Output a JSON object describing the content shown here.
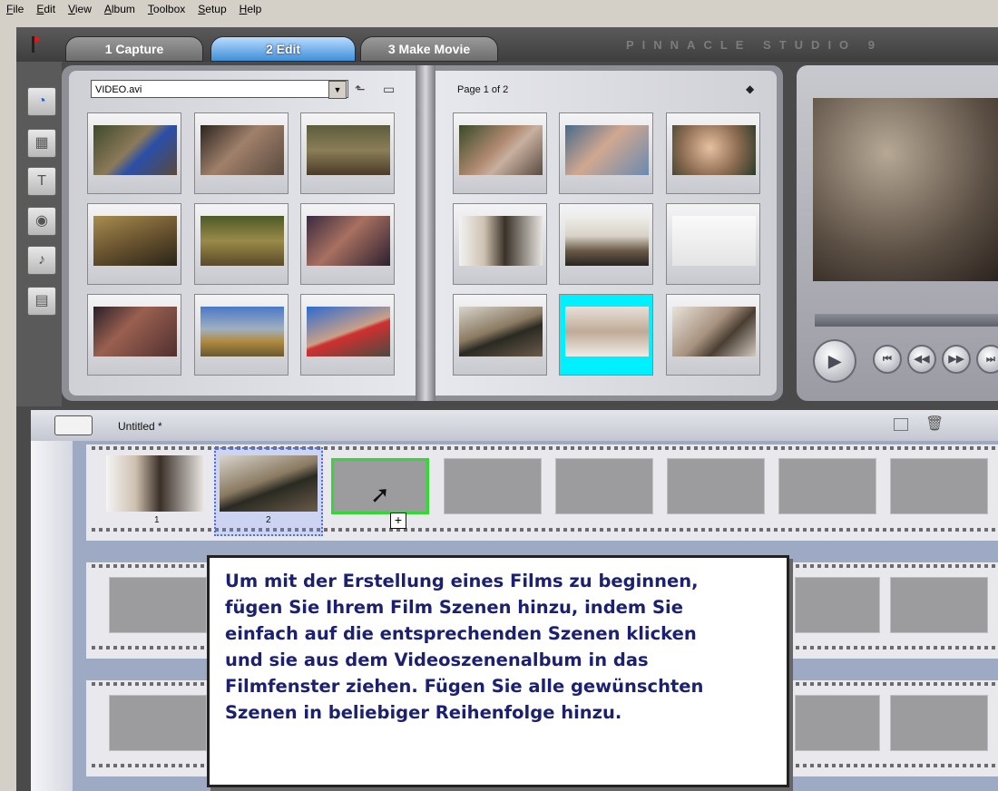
{
  "menu": [
    "File",
    "Edit",
    "View",
    "Album",
    "Toolbox",
    "Setup",
    "Help"
  ],
  "tabs": {
    "capture": "1 Capture",
    "edit": "2 Edit",
    "make_movie": "3 Make Movie"
  },
  "brand": "PINNACLE STUDIO 9",
  "album": {
    "source": "VIDEO.avi",
    "page_label": "Page 1 of 2"
  },
  "movie": {
    "title": "Untitled *",
    "clips": [
      {
        "number": "1"
      },
      {
        "number": "2"
      }
    ]
  },
  "tooltip": {
    "lines": [
      "Um mit der Erstellung eines Films zu beginnen,",
      "fügen Sie Ihrem Film Szenen hinzu, indem Sie",
      "einfach auf die entsprechenden Szenen klicken",
      "und sie aus dem Videoszenenalbum in das",
      "Filmfenster ziehen. Fügen Sie alle gewünschten",
      "Szenen in beliebiger Reihenfolge hinzu."
    ]
  },
  "colors": {
    "selected_thumb": "#00f0ff",
    "drop_target": "#34d834",
    "tooltip_text": "#1b2070",
    "active_tab": "#3f8fd8"
  },
  "icons": [
    "pinnacle-logo-icon",
    "video-tool-icon",
    "transitions-icon",
    "titles-icon",
    "photos-icon",
    "sound-icon",
    "music-icon",
    "folder-up-icon",
    "folder-icon",
    "page-flip-icon",
    "play-icon",
    "skip-back-icon",
    "rewind-icon",
    "forward-icon",
    "skip-forward-icon",
    "storyboard-icon",
    "grid-view-icon",
    "trash-icon",
    "cursor-icon",
    "add-icon"
  ]
}
